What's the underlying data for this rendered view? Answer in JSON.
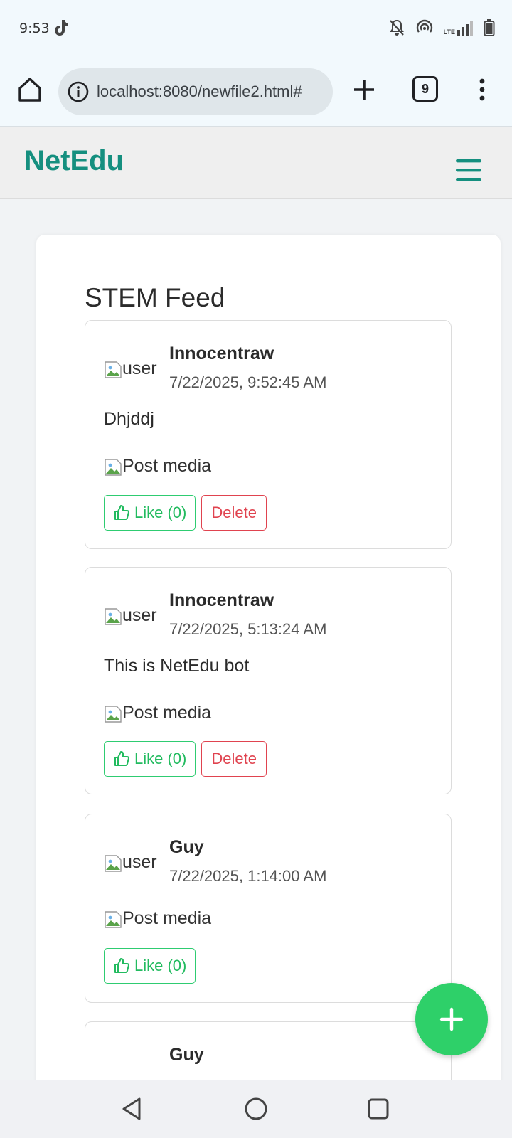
{
  "status_bar": {
    "time": "9:53",
    "icons": [
      "tiktok-icon",
      "bell-off-icon",
      "hotspot-icon",
      "lte-signal-icon",
      "battery-icon"
    ],
    "lte_label": "LTE"
  },
  "browser": {
    "url": "localhost:8080/newfile2.html#",
    "tab_count": "9"
  },
  "app": {
    "brand": "NetEdu",
    "brand_color": "#158f7f",
    "feed_title": "STEM Feed"
  },
  "posts": [
    {
      "avatar_alt": "user",
      "username": "Innocentraw",
      "timestamp": "7/22/2025, 9:52:45 AM",
      "text": "Dhjddj",
      "media_alt": "Post media",
      "like_label": "Like (0)",
      "delete_label": "Delete"
    },
    {
      "avatar_alt": "user",
      "username": "Innocentraw",
      "timestamp": "7/22/2025, 5:13:24 AM",
      "text": "This is NetEdu bot",
      "media_alt": "Post media",
      "like_label": "Like (0)",
      "delete_label": "Delete"
    },
    {
      "avatar_alt": "user",
      "username": "Guy",
      "timestamp": "7/22/2025, 1:14:00 AM",
      "media_alt": "Post media",
      "like_label": "Like (0)"
    },
    {
      "username": "Guy"
    }
  ],
  "fab": {
    "icon": "plus-icon",
    "color": "#2ed069"
  },
  "colors": {
    "like": "#22bb5f",
    "delete": "#e0434f"
  }
}
